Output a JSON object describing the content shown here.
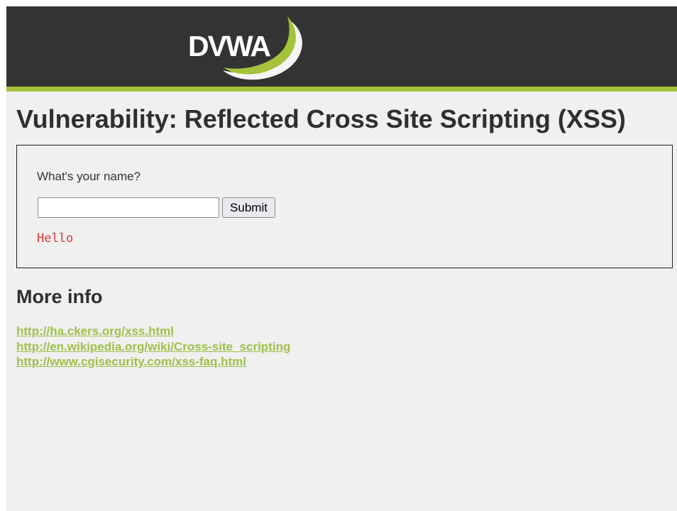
{
  "header": {
    "logo_text": "DVWA",
    "colors": {
      "background": "#333333",
      "accent": "#a4c33a"
    }
  },
  "page": {
    "title": "Vulnerability: Reflected Cross Site Scripting (XSS)"
  },
  "form": {
    "prompt": "What's your name?",
    "name_value": "",
    "submit_label": "Submit",
    "output": "Hello",
    "output_color": "#d63434"
  },
  "more_info": {
    "heading": "More info",
    "links": [
      "http://ha.ckers.org/xss.html",
      "http://en.wikipedia.org/wiki/Cross-site_scripting",
      "http://www.cgisecurity.com/xss-faq.html"
    ],
    "link_color": "#9ec14a"
  }
}
